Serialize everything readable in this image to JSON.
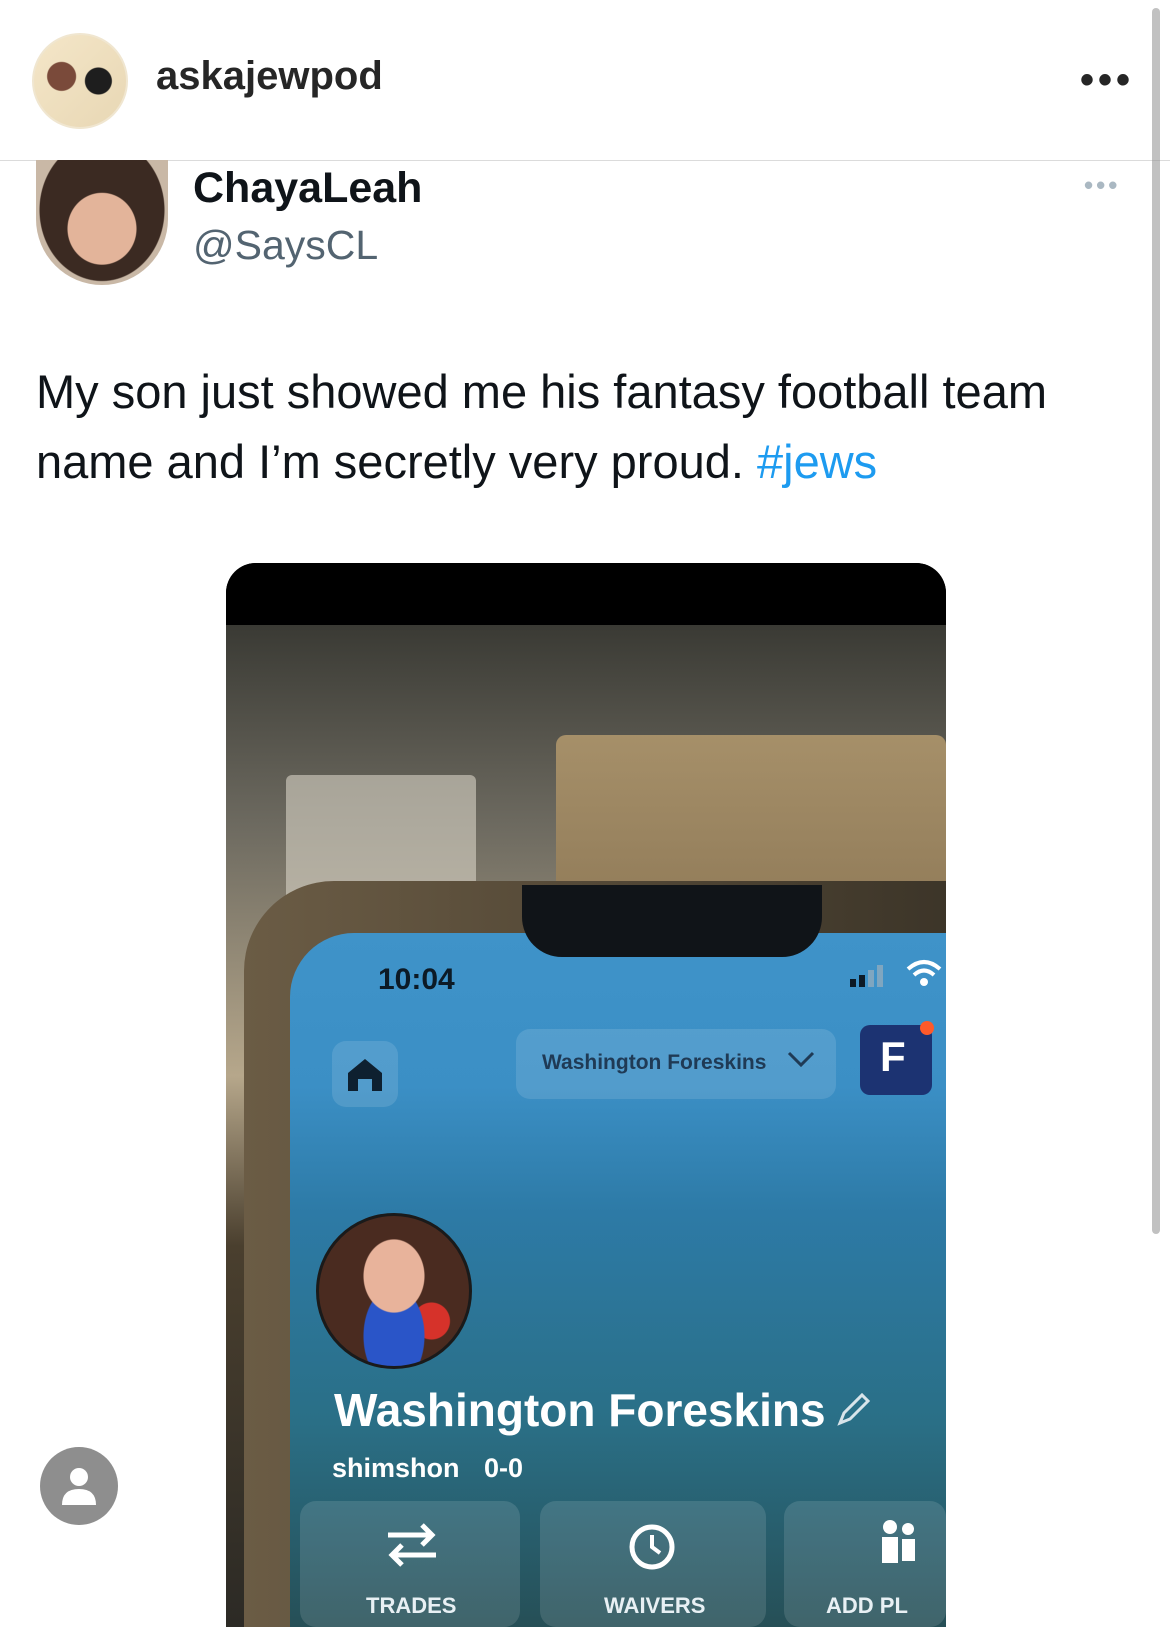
{
  "ig_header": {
    "username": "askajewpod",
    "more_label": "•••"
  },
  "tweet": {
    "display_name": "ChayaLeah",
    "handle": "@SaysCL",
    "more_label": "•••",
    "text": "My son just showed me his fantasy football team name and I’m secretly very proud. ",
    "hashtag": "#jews"
  },
  "photo": {
    "status_time": "10:04",
    "team_selector": "Washington Foreskins",
    "app_logo_letter": "F",
    "team_name": "Washington Foreskins",
    "owner": "shimshon",
    "record": "0-0",
    "actions": [
      "TRADES",
      "WAIVERS",
      "ADD PL"
    ]
  },
  "icons": {
    "profile": "person-icon",
    "home": "home-icon",
    "wifi": "wifi-icon",
    "signal": "signal-icon",
    "edit": "pencil-icon",
    "trades": "swap-arrows-icon",
    "waivers": "clock-icon",
    "add": "add-players-icon"
  },
  "colors": {
    "hashtag": "#1d9bf0",
    "handle": "#536471",
    "app_blue": "#3f93c9",
    "app_logo": "#1c3372"
  }
}
